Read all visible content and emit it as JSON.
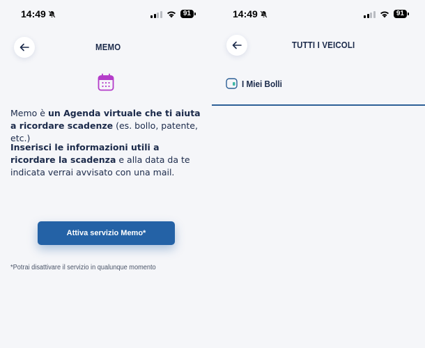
{
  "status_bar": {
    "time": "14:49",
    "battery": "91"
  },
  "memo_screen": {
    "title": "MEMO",
    "description_1_a": "Memo è ",
    "description_1_b": "un Agenda virtuale che ti aiuta a ricordare scadenze",
    "description_1_c": " (es. bollo, patente, etc.)",
    "description_2_a": "Inserisci le informazioni utili a ricordare la scadenza",
    "description_2_b": " e alla data da te indicata verrai avvisato con una mail.",
    "activate_button": "Attiva servizio Memo*",
    "footnote": "*Potrai disattivare il servizio in qualunque momento"
  },
  "vehicles_screen": {
    "title": "TUTTI I VEICOLI",
    "items": [
      {
        "label": "I Miei Bolli",
        "icon": "plate-icon"
      }
    ]
  },
  "colors": {
    "primary": "#2462a6",
    "text": "#1b2a4a",
    "calendar_icon": "#b43cc9",
    "background": "#f5f6f9"
  }
}
